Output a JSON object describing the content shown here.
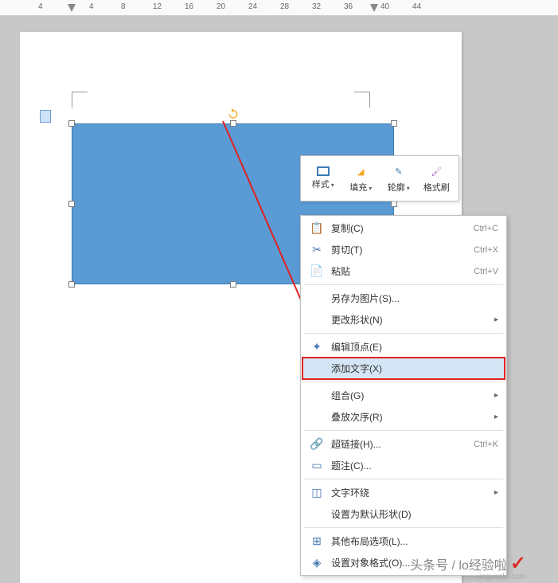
{
  "ruler": {
    "ticks": [
      4,
      4,
      8,
      12,
      16,
      20,
      24,
      28,
      32,
      36,
      40,
      44
    ]
  },
  "miniToolbar": {
    "items": [
      {
        "label": "样式",
        "hasDropdown": true
      },
      {
        "label": "填充",
        "hasDropdown": true
      },
      {
        "label": "轮廓",
        "hasDropdown": true
      },
      {
        "label": "格式刷",
        "hasDropdown": false
      }
    ]
  },
  "contextMenu": {
    "items": [
      {
        "icon": "copy",
        "label": "复制(C)",
        "shortcut": "Ctrl+C",
        "submenu": false
      },
      {
        "icon": "cut",
        "label": "剪切(T)",
        "shortcut": "Ctrl+X",
        "submenu": false
      },
      {
        "icon": "paste",
        "label": "粘贴",
        "shortcut": "Ctrl+V",
        "submenu": false
      },
      {
        "type": "separator"
      },
      {
        "icon": "",
        "label": "另存为图片(S)...",
        "shortcut": "",
        "submenu": false
      },
      {
        "icon": "",
        "label": "更改形状(N)",
        "shortcut": "",
        "submenu": true
      },
      {
        "type": "separator"
      },
      {
        "icon": "edit-points",
        "label": "编辑顶点(E)",
        "shortcut": "",
        "submenu": false
      },
      {
        "icon": "",
        "label": "添加文字(X)",
        "shortcut": "",
        "submenu": false,
        "highlighted": true
      },
      {
        "type": "separator"
      },
      {
        "icon": "",
        "label": "组合(G)",
        "shortcut": "",
        "submenu": true
      },
      {
        "icon": "",
        "label": "叠放次序(R)",
        "shortcut": "",
        "submenu": true
      },
      {
        "type": "separator"
      },
      {
        "icon": "hyperlink",
        "label": "超链接(H)...",
        "shortcut": "Ctrl+K",
        "submenu": false
      },
      {
        "icon": "caption",
        "label": "题注(C)...",
        "shortcut": "",
        "submenu": false
      },
      {
        "type": "separator"
      },
      {
        "icon": "wrap",
        "label": "文字环绕",
        "shortcut": "",
        "submenu": true
      },
      {
        "icon": "",
        "label": "设置为默认形状(D)",
        "shortcut": "",
        "submenu": false
      },
      {
        "type": "separator"
      },
      {
        "icon": "layout",
        "label": "其他布局选项(L)...",
        "shortcut": "",
        "submenu": false
      },
      {
        "icon": "format",
        "label": "设置对象格式(O)...",
        "shortcut": "",
        "submenu": false
      }
    ]
  },
  "watermark": {
    "main": "头条号 / lo经验啦",
    "sub": "jingyanla.com"
  }
}
